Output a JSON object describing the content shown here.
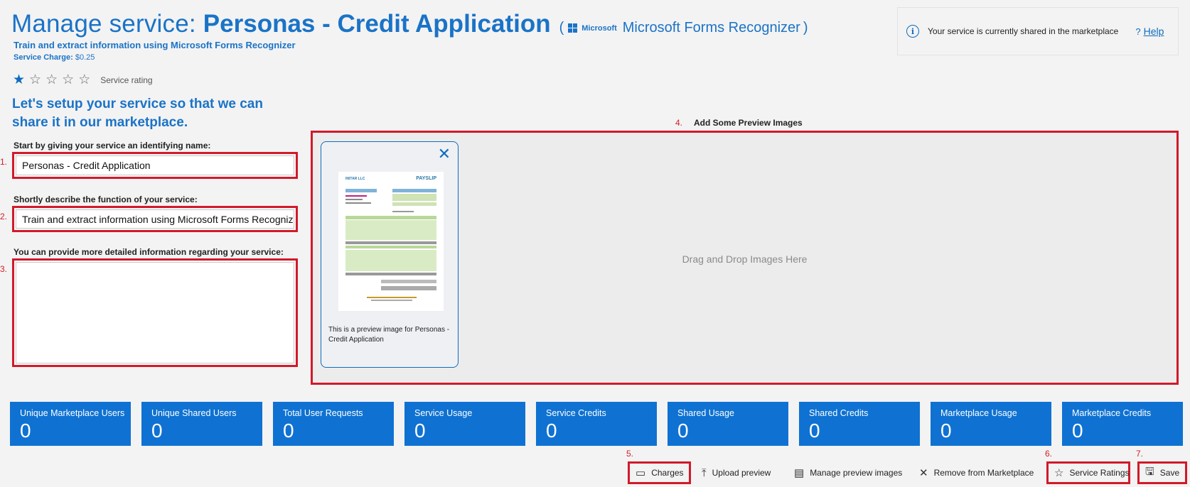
{
  "header": {
    "title_prefix": "Manage service:",
    "title_name": "Personas - Credit Application",
    "provider_open": "(",
    "provider_brand": "Microsoft",
    "provider_name": "Microsoft Forms Recognizer",
    "provider_close": ")",
    "subtitle": "Train and extract information using Microsoft Forms Recognizer",
    "charge_label": "Service Charge:",
    "charge_value": "$0.25",
    "rating_label": "Service rating",
    "rating_value": 1,
    "rating_max": 5
  },
  "info": {
    "icon": "info-icon",
    "message": "Your service is currently shared in the marketplace",
    "help_q": "?",
    "help_label": "Help"
  },
  "form": {
    "heading": "Let's setup your service so that we can share it in our marketplace.",
    "name_number": "1.",
    "name_label": "Start by giving your service an identifying name:",
    "name_value": "Personas - Credit Application",
    "desc_number": "2.",
    "desc_label": "Shortly describe the function of your service:",
    "desc_value": "Train and extract information using Microsoft Forms Recognizer",
    "detail_number": "3.",
    "detail_label": "You can provide more detailed information regarding your service:",
    "detail_value": ""
  },
  "preview": {
    "number": "4.",
    "heading": "Add Some Preview Images",
    "drop_text": "Drag and Drop Images Here",
    "card_caption": "This is a preview image for Personas - Credit Application",
    "thumb_company": "INITAR LLC",
    "thumb_tag": "PAYSLIP"
  },
  "stats": [
    {
      "label": "Unique Marketplace Users",
      "value": "0"
    },
    {
      "label": "Unique Shared Users",
      "value": "0"
    },
    {
      "label": "Total User Requests",
      "value": "0"
    },
    {
      "label": "Service Usage",
      "value": "0"
    },
    {
      "label": "Service Credits",
      "value": "0"
    },
    {
      "label": "Shared Usage",
      "value": "0"
    },
    {
      "label": "Shared Credits",
      "value": "0"
    },
    {
      "label": "Marketplace Usage",
      "value": "0"
    },
    {
      "label": "Marketplace Credits",
      "value": "0"
    }
  ],
  "toolbar": {
    "charges_number": "5.",
    "charges": "Charges",
    "upload_preview": "Upload preview",
    "manage_preview": "Manage preview images",
    "remove_marketplace": "Remove from Marketplace",
    "ratings_number": "6.",
    "service_ratings": "Service Ratings",
    "save_number": "7.",
    "save": "Save"
  },
  "colors": {
    "accent": "#0f6cbd",
    "tile": "#0f72d2",
    "highlight": "#d11a2a"
  }
}
